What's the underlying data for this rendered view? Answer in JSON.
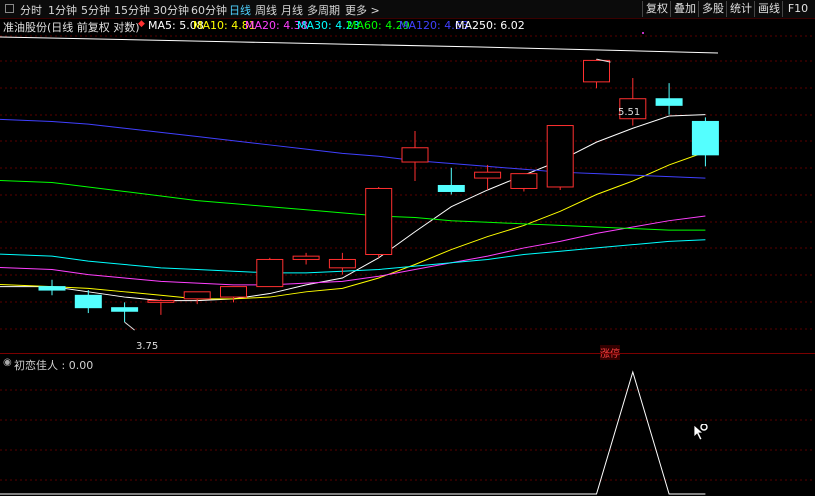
{
  "toolbar": {
    "periods": [
      "分时",
      "1分钟",
      "5分钟",
      "15分钟",
      "30分钟",
      "60分钟",
      "日线",
      "周线",
      "月线",
      "多周期",
      "更多 >"
    ],
    "active_period": "日线",
    "right_buttons": [
      "复权",
      "叠加",
      "多股",
      "统计",
      "画线",
      "F10"
    ]
  },
  "legend": {
    "title": "准油股份(日线 前复权 对数)",
    "ma_labels": [
      "MA5: 5.08",
      "MA10: 4.81",
      "MA20: 4.38",
      "MA30: 4.23",
      "MA60: 4.29",
      "MA120: 4.63",
      "MA250: 6.02"
    ],
    "ma_colors": [
      "#ffffff",
      "#ffff00",
      "#ff40ff",
      "#00ffff",
      "#00ff00",
      "#4040ff",
      "#ffffff"
    ]
  },
  "annotations": {
    "high": "5.51",
    "low": "3.75",
    "tag": "涨停"
  },
  "indicator": {
    "label": "初恋佳人 : 0.00"
  },
  "colors": {
    "up": "#ff3030",
    "down": "#54ffff",
    "grid": "#5a0000",
    "indicator": "#ffffff"
  },
  "chart_data": {
    "type": "candlestick",
    "y_scale": "log",
    "ylim": [
      3.6,
      5.7
    ],
    "candles": [
      {
        "o": 3.95,
        "h": 3.99,
        "l": 3.9,
        "c": 3.93
      },
      {
        "o": 3.9,
        "h": 3.93,
        "l": 3.8,
        "c": 3.83
      },
      {
        "o": 3.83,
        "h": 3.86,
        "l": 3.75,
        "c": 3.81
      },
      {
        "o": 3.86,
        "h": 3.88,
        "l": 3.79,
        "c": 3.87
      },
      {
        "o": 3.88,
        "h": 3.91,
        "l": 3.85,
        "c": 3.92
      },
      {
        "o": 3.89,
        "h": 3.93,
        "l": 3.86,
        "c": 3.95
      },
      {
        "o": 3.95,
        "h": 4.12,
        "l": 3.95,
        "c": 4.11
      },
      {
        "o": 4.11,
        "h": 4.15,
        "l": 4.08,
        "c": 4.13
      },
      {
        "o": 4.06,
        "h": 4.15,
        "l": 4.02,
        "c": 4.11
      },
      {
        "o": 4.14,
        "h": 4.57,
        "l": 4.12,
        "c": 4.56
      },
      {
        "o": 4.74,
        "h": 4.96,
        "l": 4.61,
        "c": 4.84
      },
      {
        "o": 4.58,
        "h": 4.7,
        "l": 4.52,
        "c": 4.54
      },
      {
        "o": 4.63,
        "h": 4.72,
        "l": 4.55,
        "c": 4.67
      },
      {
        "o": 4.56,
        "h": 4.66,
        "l": 4.54,
        "c": 4.66
      },
      {
        "o": 4.57,
        "h": 5.0,
        "l": 4.55,
        "c": 5.0
      },
      {
        "o": 5.33,
        "h": 5.51,
        "l": 5.28,
        "c": 5.5
      },
      {
        "o": 5.05,
        "h": 5.36,
        "l": 5.0,
        "c": 5.2
      },
      {
        "o": 5.2,
        "h": 5.32,
        "l": 5.08,
        "c": 5.15
      },
      {
        "o": 5.03,
        "h": 5.06,
        "l": 4.71,
        "c": 4.79
      }
    ],
    "ma_series": [
      {
        "name": "MA5",
        "values": [
          3.95,
          3.92,
          3.89,
          3.87,
          3.87,
          3.88,
          3.91,
          3.96,
          4.0,
          4.12,
          4.28,
          4.44,
          4.55,
          4.65,
          4.75,
          4.88,
          4.98,
          5.07,
          5.08
        ]
      },
      {
        "name": "MA10",
        "values": [
          3.95,
          3.94,
          3.92,
          3.9,
          3.88,
          3.88,
          3.89,
          3.92,
          3.94,
          4.0,
          4.08,
          4.17,
          4.25,
          4.32,
          4.41,
          4.52,
          4.61,
          4.72,
          4.81
        ]
      },
      {
        "name": "MA20",
        "values": [
          4.05,
          4.02,
          4.0,
          3.98,
          3.97,
          3.96,
          3.96,
          3.97,
          3.98,
          4.01,
          4.05,
          4.09,
          4.13,
          4.18,
          4.22,
          4.27,
          4.31,
          4.35,
          4.38
        ]
      },
      {
        "name": "MA30",
        "values": [
          4.13,
          4.1,
          4.08,
          4.06,
          4.05,
          4.04,
          4.03,
          4.03,
          4.04,
          4.05,
          4.07,
          4.09,
          4.11,
          4.14,
          4.16,
          4.18,
          4.2,
          4.22,
          4.23
        ]
      },
      {
        "name": "MA60",
        "values": [
          4.6,
          4.57,
          4.54,
          4.51,
          4.48,
          4.46,
          4.44,
          4.42,
          4.4,
          4.38,
          4.37,
          4.35,
          4.34,
          4.33,
          4.32,
          4.31,
          4.3,
          4.29,
          4.29
        ]
      },
      {
        "name": "MA120",
        "values": [
          5.03,
          5.01,
          4.98,
          4.95,
          4.92,
          4.89,
          4.86,
          4.83,
          4.8,
          4.78,
          4.75,
          4.73,
          4.71,
          4.69,
          4.67,
          4.66,
          4.65,
          4.64,
          4.63
        ]
      }
    ],
    "indicator_values": [
      0,
      0,
      0,
      0,
      0,
      0,
      0,
      0,
      0,
      0,
      0,
      0,
      0,
      0,
      0,
      0,
      1,
      0,
      0
    ]
  }
}
